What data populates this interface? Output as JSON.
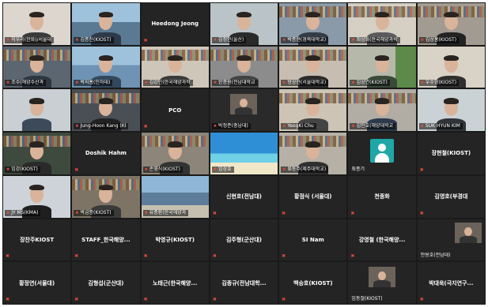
{
  "meeting": {
    "tiles": [
      {
        "type": "video",
        "label": "이우리(한화)/서울대",
        "bg": "#ddd6cf",
        "torso": "#3b3b3b",
        "scene": "office"
      },
      {
        "type": "video",
        "label": "김종진(KIOST)",
        "bg": "#5a7a93",
        "torso": "#2d3a4a",
        "scene": "ship"
      },
      {
        "type": "name",
        "label": "Heedong Jeong"
      },
      {
        "type": "video",
        "label": "김정인(울산)",
        "bg": "#b9c3c8",
        "torso": "#2a2a2a",
        "scene": "office"
      },
      {
        "type": "video",
        "label": "박종현(경북대학교)",
        "bg": "#8a9aa8",
        "torso": "#333b45",
        "scene": "shelf"
      },
      {
        "type": "video",
        "label": "최상화(한국해양과학",
        "bg": "#d5cfc4",
        "torso": "#5b5b5b",
        "scene": "shelf"
      },
      {
        "type": "video",
        "label": "김상홍(KIOST)",
        "bg": "#a29b91",
        "torso": "#232323",
        "scene": "shelf"
      },
      {
        "type": "video",
        "label": "조수(해양수산과",
        "bg": "#5c6670",
        "torso": "#2e3640",
        "scene": "shelf"
      },
      {
        "type": "video",
        "label": "박지홍(인하대)",
        "bg": "#6f93b4",
        "torso": "#33485c",
        "scene": "sea"
      },
      {
        "type": "video",
        "label": "김강민(한국해양과학",
        "bg": "#cfc6ba",
        "torso": "#3a3a3a",
        "scene": "shelf"
      },
      {
        "type": "video",
        "label": "한종원(전남대학교",
        "bg": "#8c8c8c",
        "torso": "#444444",
        "scene": "shelf"
      },
      {
        "type": "video",
        "label": "방상현(서울대학교)",
        "bg": "#c7bdb0",
        "torso": "#2b2b2b",
        "scene": "shelf"
      },
      {
        "type": "video",
        "label": "김상연(KIOST)",
        "bg": "#b6b8aa",
        "torso": "#3a4a3a",
        "scene": "plant"
      },
      {
        "type": "video",
        "label": "우수영(KIOST)",
        "bg": "#d9d2c6",
        "torso": "#2f2f2f",
        "scene": "office"
      },
      {
        "type": "video",
        "label": "",
        "bg": "#c9cfd3",
        "torso": "#3d4a5a",
        "scene": "office"
      },
      {
        "type": "video",
        "label": "Jung-Hoon Kang (KI",
        "bg": "#4a4f55",
        "torso": "#222222",
        "scene": "shelf"
      },
      {
        "type": "name",
        "label": "PCO"
      },
      {
        "type": "video",
        "label": "박정준(충남대)",
        "bg": "#2a2a2a",
        "torso": "#3b3b3b",
        "scene": "small"
      },
      {
        "type": "video",
        "label": "YeogKi Chu",
        "bg": "#cdc4b6",
        "torso": "#444444",
        "scene": "shelf"
      },
      {
        "type": "video",
        "label": "김민호(해양대학교",
        "bg": "#b1aca4",
        "torso": "#2c3a4c",
        "scene": "shelf"
      },
      {
        "type": "video",
        "label": "SUK HYUN KIM",
        "bg": "#cbd2d6",
        "torso": "#30343a",
        "scene": "office"
      },
      {
        "type": "video",
        "label": "임강(KIOST)",
        "bg": "#3e4a3e",
        "torso": "#2a2a2a",
        "scene": "shelf"
      },
      {
        "type": "name",
        "label": "Doshik Hahm"
      },
      {
        "type": "video",
        "label": "손영식(KIOST)",
        "bg": "#8d8579",
        "torso": "#333333",
        "scene": "shelf"
      },
      {
        "type": "video",
        "label": "임상호",
        "bg": "#3aa0d8",
        "torso": "#2a2a2a",
        "scene": "beach"
      },
      {
        "type": "video",
        "label": "류동주(제주대학교)",
        "bg": "#b7b0a6",
        "torso": "#303030",
        "scene": "shelf"
      },
      {
        "type": "avatar",
        "label": "최종기"
      },
      {
        "type": "name",
        "label": "장현철(KIOST)"
      },
      {
        "type": "video",
        "label": "JY MS(KMA)",
        "bg": "#cdd3d8",
        "torso": "#1f1f1f",
        "scene": "office"
      },
      {
        "type": "video",
        "label": "박금종(KIOST)",
        "bg": "#7d7466",
        "torso": "#3a3a3a",
        "scene": "shelf"
      },
      {
        "type": "video",
        "label": "유종환(한국해양과",
        "bg": "#5d86ab",
        "torso": "#2f2f2f",
        "scene": "city"
      },
      {
        "type": "name",
        "label": "신현호(전남대)"
      },
      {
        "type": "name",
        "label": "황점식 (서울대)"
      },
      {
        "type": "name",
        "label": "천종화"
      },
      {
        "type": "name",
        "label": "김영호(부경대"
      },
      {
        "type": "name",
        "label": "장찬주KIOST"
      },
      {
        "type": "name",
        "label": "STAFF_한국해양..."
      },
      {
        "type": "name",
        "label": "박영규(KIOST)"
      },
      {
        "type": "name",
        "label": "김주형(군산대)"
      },
      {
        "type": "name",
        "label": "SI Nam"
      },
      {
        "type": "name",
        "label": "강영철 (한국해양..."
      },
      {
        "type": "smallvideo",
        "label": "안용호(전남대)",
        "align": "right"
      },
      {
        "type": "name",
        "label": "황정연(서울대)"
      },
      {
        "type": "name",
        "label": "김형섭(군산대)"
      },
      {
        "type": "name",
        "label": "노태근(한국해양..."
      },
      {
        "type": "name",
        "label": "김종규(전남대학..."
      },
      {
        "type": "name",
        "label": "백승호(KIOST)"
      },
      {
        "type": "smallvideo",
        "label": "임동철(KIOST)",
        "align": "center"
      },
      {
        "type": "name",
        "label": "박대욱(극지연구..."
      }
    ]
  }
}
